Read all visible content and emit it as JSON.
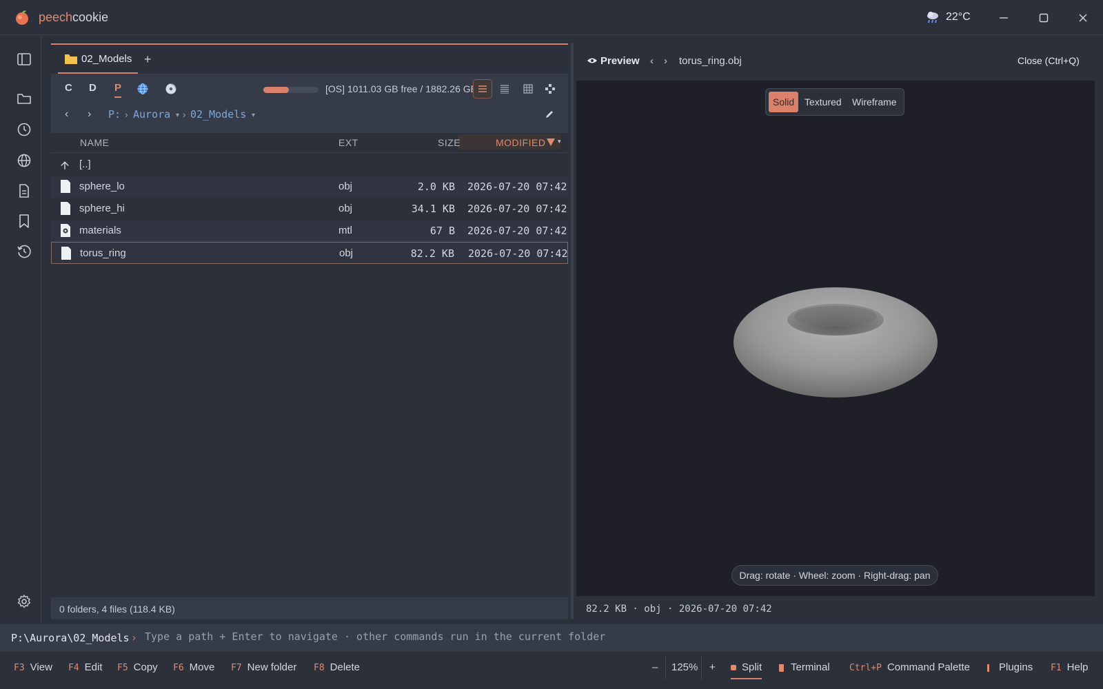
{
  "app": {
    "name_accent": "peech",
    "name_rest": "cookie",
    "logo": "peach-icon"
  },
  "weather": {
    "icon": "cloud-rain-icon",
    "temp": "22°C"
  },
  "window_controls": [
    "minimize-icon",
    "maximize-icon",
    "close-icon"
  ],
  "rail": [
    "sidebar-toggle-icon",
    "folder-icon",
    "clock-icon",
    "globe-icon",
    "document-icon",
    "bookmark-icon",
    "history-icon",
    "gear-icon"
  ],
  "tabs": [
    {
      "label": "02_Models",
      "icon": "folder-icon"
    }
  ],
  "tab_add": "+",
  "drives": [
    "C",
    "D",
    "P"
  ],
  "drive_icons": [
    "network-globe-icon",
    "disc-icon"
  ],
  "disk": {
    "text": "[OS] 1011.03 GB free / 1882.26 GB",
    "used_fraction": 0.46
  },
  "breadcrumb": {
    "back": "‹",
    "forward": "›",
    "parts": [
      "P:",
      "Aurora",
      "02_Models"
    ]
  },
  "columns": {
    "name": "NAME",
    "ext": "EXT",
    "size": "SIZE",
    "modified": "MODIFIED"
  },
  "parent_row": "[..]",
  "files": [
    {
      "name": "sphere_lo",
      "ext": "obj",
      "size": "2.0 KB",
      "modified": "2026-07-20 07:42",
      "icon": "file-icon"
    },
    {
      "name": "sphere_hi",
      "ext": "obj",
      "size": "34.1 KB",
      "modified": "2026-07-20 07:42",
      "icon": "file-icon"
    },
    {
      "name": "materials",
      "ext": "mtl",
      "size": "67 B",
      "modified": "2026-07-20 07:42",
      "icon": "settings-file-icon"
    },
    {
      "name": "torus_ring",
      "ext": "obj",
      "size": "82.2 KB",
      "modified": "2026-07-20 07:42",
      "icon": "file-icon"
    }
  ],
  "status": "0 folders, 4 files (118.4 KB)",
  "preview": {
    "title": "Preview",
    "nav_back": "‹",
    "nav_forward": "›",
    "filename": "torus_ring.obj",
    "close": "Close (Ctrl+Q)",
    "modes": [
      "Solid",
      "Textured",
      "Wireframe"
    ],
    "active_mode": "Solid",
    "hint": "Drag: rotate · Wheel: zoom · Right-drag: pan",
    "meta": "82.2 KB · obj · 2026-07-20 07:42"
  },
  "command": {
    "path": "P:\\Aurora\\02_Models",
    "arrow": "›",
    "placeholder": "Type a path + Enter to navigate · other commands run in the current folder"
  },
  "fkeys": [
    {
      "key": "F3",
      "label": "View"
    },
    {
      "key": "F4",
      "label": "Edit"
    },
    {
      "key": "F5",
      "label": "Copy"
    },
    {
      "key": "F6",
      "label": "Move"
    },
    {
      "key": "F7",
      "label": "New folder"
    },
    {
      "key": "F8",
      "label": "Delete"
    }
  ],
  "zoom": {
    "minus": "–",
    "value": "125%",
    "plus": "+"
  },
  "right_actions": {
    "split": "Split",
    "terminal": "Terminal",
    "palette_key": "Ctrl+P",
    "palette": "Command Palette",
    "plugins": "Plugins",
    "help_key": "F1",
    "help": "Help"
  },
  "colors": {
    "accent": "#d9816a",
    "background": "#2b303b",
    "viewport": "#1f2027",
    "link": "#7ea6d8"
  }
}
